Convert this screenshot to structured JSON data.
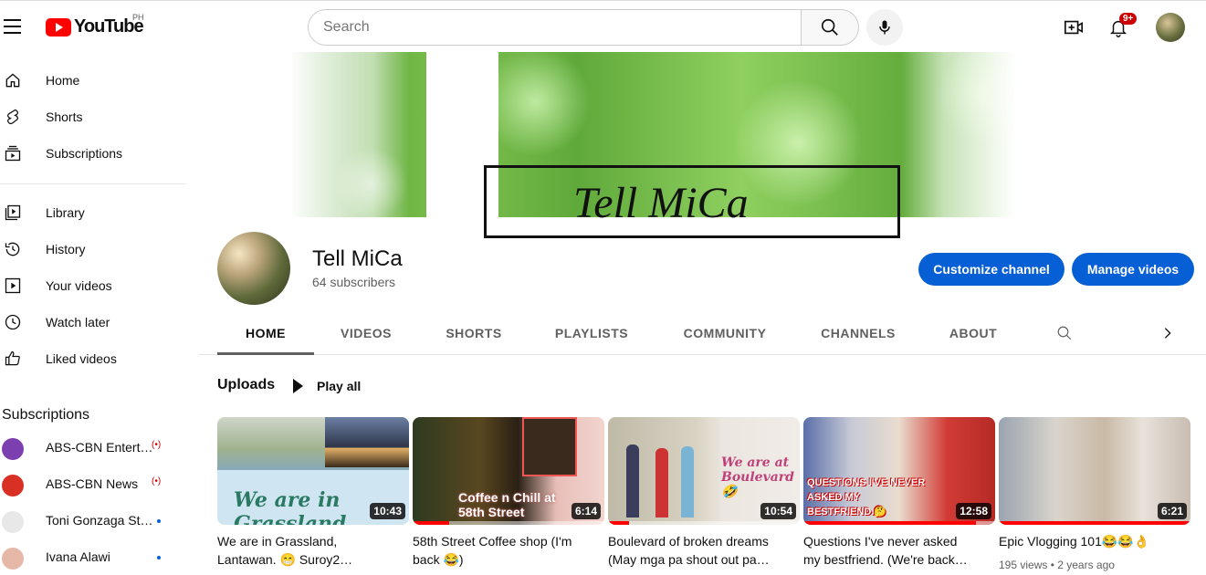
{
  "header": {
    "logo_text": "YouTube",
    "country_code": "PH",
    "search_placeholder": "Search",
    "notification_count": "9+"
  },
  "sidebar": {
    "primary": [
      {
        "label": "Home",
        "icon": "home-icon"
      },
      {
        "label": "Shorts",
        "icon": "shorts-icon"
      },
      {
        "label": "Subscriptions",
        "icon": "subscriptions-icon"
      }
    ],
    "library": [
      {
        "label": "Library",
        "icon": "library-icon"
      },
      {
        "label": "History",
        "icon": "history-icon"
      },
      {
        "label": "Your videos",
        "icon": "your-videos-icon"
      },
      {
        "label": "Watch later",
        "icon": "watch-later-icon"
      },
      {
        "label": "Liked videos",
        "icon": "liked-videos-icon"
      }
    ],
    "subscriptions_heading": "Subscriptions",
    "subscriptions": [
      {
        "name": "ABS-CBN Entertainment",
        "indicator": "live",
        "avatar_color": "#7b3fb0"
      },
      {
        "name": "ABS-CBN News",
        "indicator": "live",
        "avatar_color": "#d93025"
      },
      {
        "name": "Toni Gonzaga Studio",
        "indicator": "new",
        "avatar_color": "#e8e8e8"
      },
      {
        "name": "Ivana Alawi",
        "indicator": "new",
        "avatar_color": "#e6b8a8"
      }
    ]
  },
  "banner": {
    "title": "Tell MiCa"
  },
  "channel": {
    "name": "Tell MiCa",
    "subscribers": "64 subscribers",
    "customize_label": "Customize channel",
    "manage_label": "Manage videos"
  },
  "tabs": [
    {
      "label": "HOME",
      "active": true
    },
    {
      "label": "VIDEOS",
      "active": false
    },
    {
      "label": "SHORTS",
      "active": false
    },
    {
      "label": "PLAYLISTS",
      "active": false
    },
    {
      "label": "COMMUNITY",
      "active": false
    },
    {
      "label": "CHANNELS",
      "active": false
    },
    {
      "label": "ABOUT",
      "active": false
    }
  ],
  "uploads": {
    "heading": "Uploads",
    "play_all": "Play all",
    "videos": [
      {
        "title_line1": "We are in Grassland,",
        "title_line2": "Lantawan. 😁 Suroy2…",
        "duration": "10:43",
        "caption": "We are in Grassland",
        "meta": "",
        "progress": 0.0
      },
      {
        "title_line1": "58th Street Coffee shop (I'm",
        "title_line2": "back 😂)",
        "duration": "6:14",
        "caption": "Coffee n Chill at 58th Street",
        "meta": "",
        "progress": 0.19
      },
      {
        "title_line1": "Boulevard of broken dreams",
        "title_line2": "(May mga pa shout out pa…",
        "duration": "10:54",
        "caption": "We are at Boulevard 🤣",
        "meta": "",
        "progress": 0.11
      },
      {
        "title_line1": "Questions I've never asked",
        "title_line2": "my bestfriend. (We're back…",
        "duration": "12:58",
        "caption": "QUESTIONS I'VE NEVER ASKED MY BESTFRIEND.🤔",
        "meta": "",
        "progress": 0.9
      },
      {
        "title_line1": "Epic Vlogging 101😂😂👌",
        "title_line2": "",
        "duration": "6:21",
        "caption": "",
        "meta": "195 views • 2 years ago",
        "progress": 1.0
      }
    ]
  },
  "colors": {
    "accent_blue": "#065fd4",
    "youtube_red": "#ff0000"
  }
}
